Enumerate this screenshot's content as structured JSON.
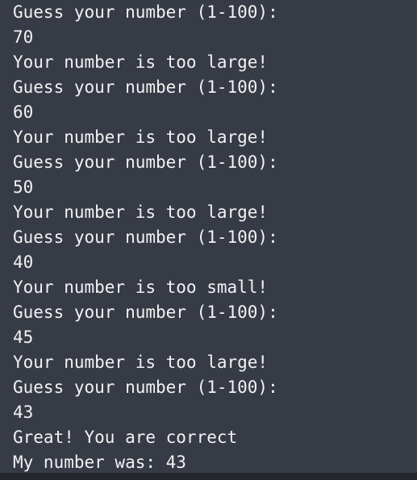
{
  "terminal": {
    "lines": [
      "Guess your number (1-100):",
      "70",
      "Your number is too large!",
      "Guess your number (1-100):",
      "60",
      "Your number is too large!",
      "Guess your number (1-100):",
      "50",
      "Your number is too large!",
      "Guess your number (1-100):",
      "40",
      "Your number is too small!",
      "Guess your number (1-100):",
      "45",
      "Your number is too large!",
      "Guess your number (1-100):",
      "43",
      "Great! You are correct",
      "My number was: 43"
    ]
  }
}
